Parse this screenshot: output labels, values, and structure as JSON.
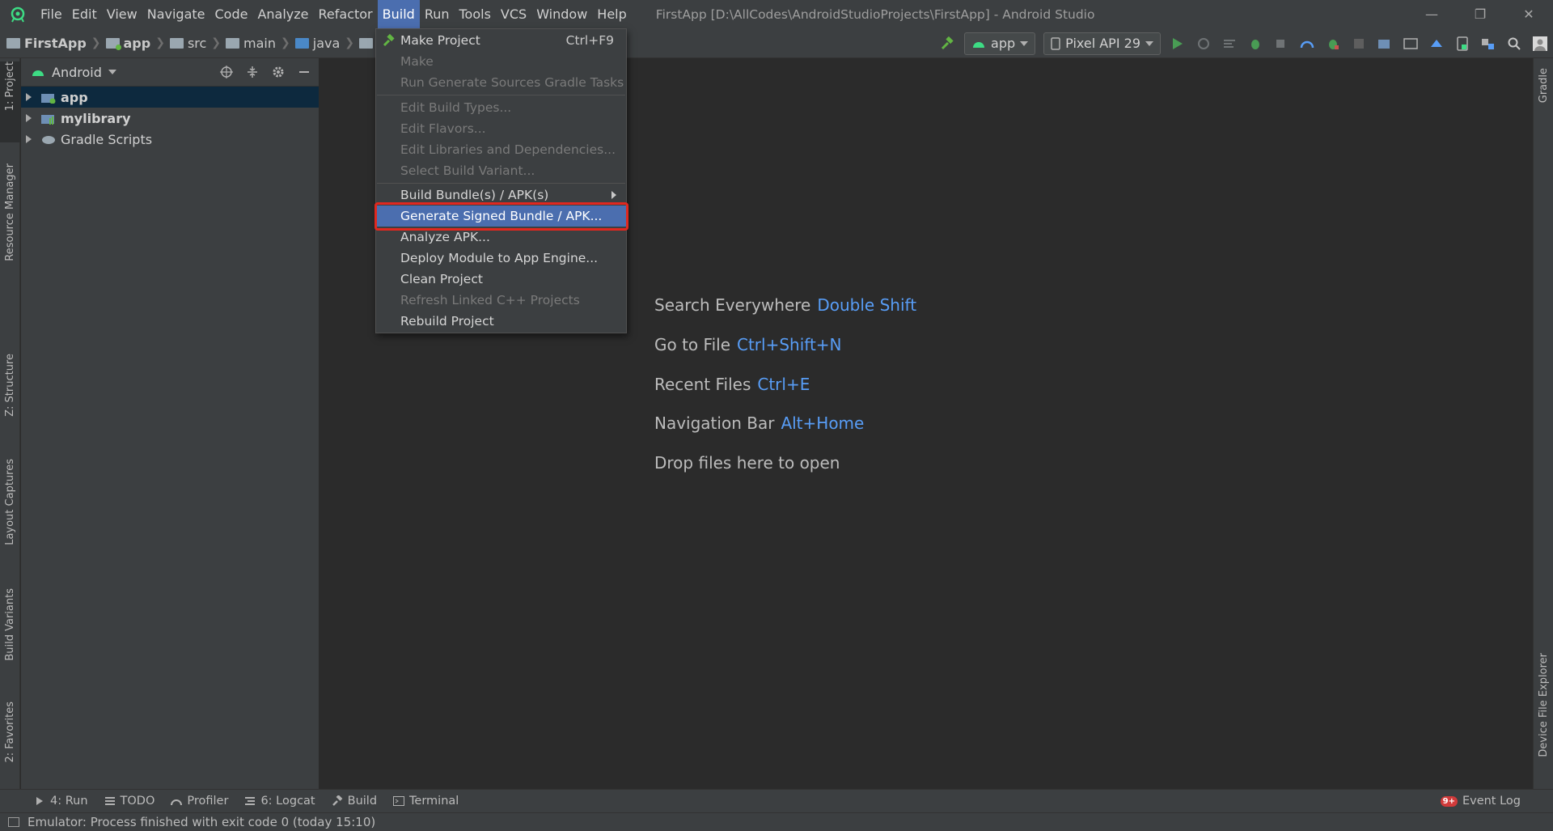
{
  "menubar": {
    "items": [
      "File",
      "Edit",
      "View",
      "Navigate",
      "Code",
      "Analyze",
      "Refactor",
      "Build",
      "Run",
      "Tools",
      "VCS",
      "Window",
      "Help"
    ],
    "active_item": "Build",
    "window_title": "FirstApp [D:\\AllCodes\\AndroidStudioProjects\\FirstApp] - Android Studio",
    "minimize": "—",
    "restore": "❐",
    "close": "✕"
  },
  "breadcrumb": {
    "items": [
      "FirstApp",
      "app",
      "src",
      "main",
      "java",
      "com"
    ]
  },
  "toolbar": {
    "run_config": "app",
    "device": "Pixel API 29"
  },
  "left_tabs": {
    "project": "1: Project",
    "resource_manager": "Resource Manager",
    "structure": "Z: Structure",
    "layout_captures": "Layout Captures",
    "build_variants": "Build Variants",
    "favorites": "2: Favorites"
  },
  "right_tabs": {
    "gradle": "Gradle",
    "device_file_explorer": "Device File Explorer"
  },
  "project_panel": {
    "view_mode": "Android",
    "tree": [
      {
        "label": "app",
        "bold": true,
        "selected": true
      },
      {
        "label": "mylibrary",
        "bold": true,
        "selected": false
      },
      {
        "label": "Gradle Scripts",
        "bold": false,
        "selected": false
      }
    ]
  },
  "build_menu": {
    "items": [
      {
        "label": "Make Project",
        "shortcut": "Ctrl+F9",
        "disabled": false
      },
      {
        "label": "Make",
        "shortcut": "",
        "disabled": true
      },
      {
        "label": "Run Generate Sources Gradle Tasks",
        "shortcut": "",
        "disabled": true
      },
      {
        "label": "Edit Build Types...",
        "shortcut": "",
        "disabled": true
      },
      {
        "label": "Edit Flavors...",
        "shortcut": "",
        "disabled": true
      },
      {
        "label": "Edit Libraries and Dependencies...",
        "shortcut": "",
        "disabled": true
      },
      {
        "label": "Select Build Variant...",
        "shortcut": "",
        "disabled": true
      },
      {
        "label": "Build Bundle(s) / APK(s)",
        "shortcut": "",
        "disabled": false,
        "submenu": true
      },
      {
        "label": "Generate Signed Bundle / APK...",
        "shortcut": "",
        "disabled": false,
        "highlighted": true
      },
      {
        "label": "Analyze APK...",
        "shortcut": "",
        "disabled": false
      },
      {
        "label": "Deploy Module to App Engine...",
        "shortcut": "",
        "disabled": false
      },
      {
        "label": "Clean Project",
        "shortcut": "",
        "disabled": false
      },
      {
        "label": "Refresh Linked C++ Projects",
        "shortcut": "",
        "disabled": true
      },
      {
        "label": "Rebuild Project",
        "shortcut": "",
        "disabled": false
      }
    ]
  },
  "editor_hints": [
    {
      "label": "Search Everywhere",
      "key": "Double Shift"
    },
    {
      "label": "Go to File",
      "key": "Ctrl+Shift+N"
    },
    {
      "label": "Recent Files",
      "key": "Ctrl+E"
    },
    {
      "label": "Navigation Bar",
      "key": "Alt+Home"
    },
    {
      "label": "Drop files here to open",
      "key": ""
    }
  ],
  "bottom_tools": {
    "run": "4: Run",
    "todo": "TODO",
    "profiler": "Profiler",
    "logcat": "6: Logcat",
    "build": "Build",
    "terminal": "Terminal",
    "event_log": "Event Log",
    "event_badge": "9+"
  },
  "status": {
    "message": "Emulator: Process finished with exit code 0 (today 15:10)"
  },
  "colors": {
    "accent": "#4b6eaf",
    "highlight_border": "#e0281f",
    "hint_key": "#589df6",
    "android_green": "#3ddc84"
  }
}
